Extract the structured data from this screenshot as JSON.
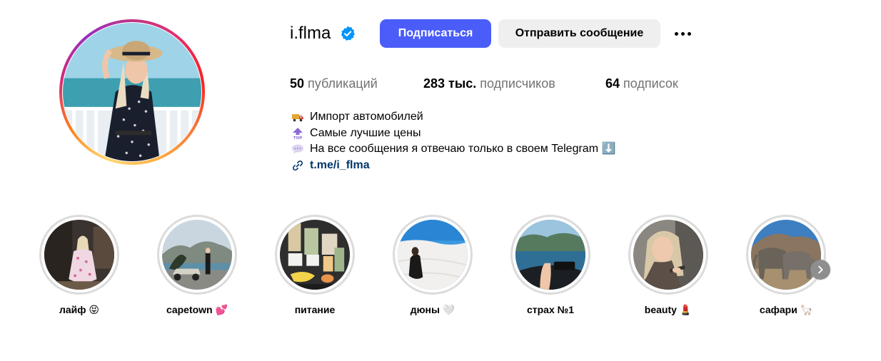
{
  "profile": {
    "username": "i.flma",
    "verified_icon": "verified-badge-icon",
    "follow_label": "Подписаться",
    "message_label": "Отправить сообщение",
    "more_icon": "more-options-icon"
  },
  "stats": {
    "posts": {
      "value": "50",
      "label": "публикаций"
    },
    "followers": {
      "value": "283 тыс.",
      "label": "подписчиков"
    },
    "following": {
      "value": "64",
      "label": "подписок"
    }
  },
  "bio": {
    "lines": [
      {
        "icon": "truck-emoji",
        "text": "Импорт автомобилей"
      },
      {
        "icon": "top-arrow-emoji",
        "text": "Самые лучшие цены"
      },
      {
        "icon": "speech-bubble-emoji",
        "text": "На все сообщения я отвечаю только в своем Telegram ⬇️"
      }
    ],
    "link_icon": "link-icon",
    "link": "t.me/i_flma"
  },
  "highlights": [
    {
      "label": "лайф 😝"
    },
    {
      "label": "capetown 💕"
    },
    {
      "label": "питание"
    },
    {
      "label": "дюны 🤍"
    },
    {
      "label": "страх №1"
    },
    {
      "label": "beauty 💄"
    },
    {
      "label": "сафари 🦙"
    }
  ],
  "colors": {
    "accent": "#4a5df9",
    "verified": "#0095f6",
    "link": "#00376b",
    "secondary_text": "#737373"
  }
}
